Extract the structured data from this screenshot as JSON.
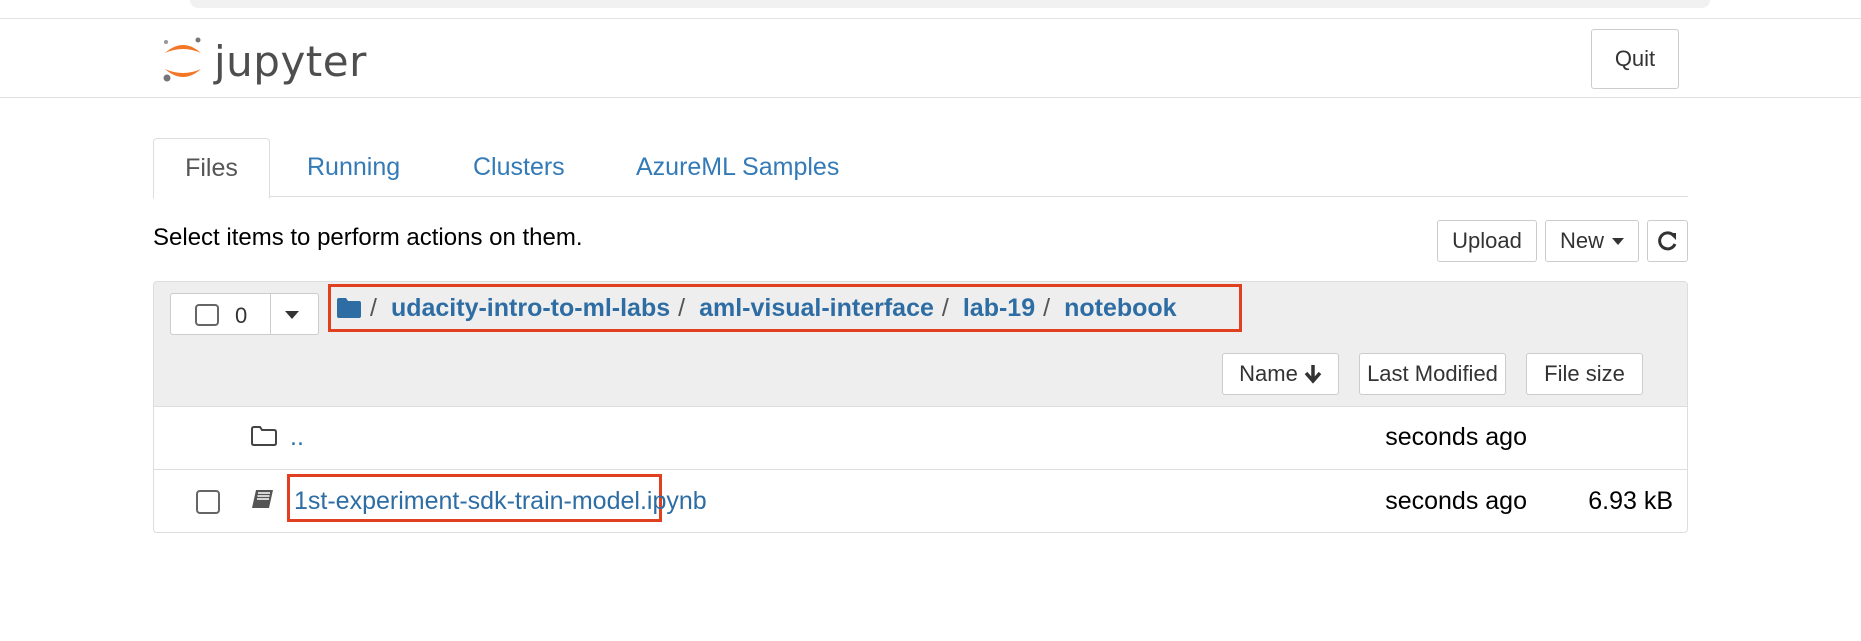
{
  "app": {
    "logo_text": "jupyter",
    "quit_label": "Quit"
  },
  "tabs": [
    {
      "label": "Files",
      "active": true
    },
    {
      "label": "Running",
      "active": false
    },
    {
      "label": "Clusters",
      "active": false
    },
    {
      "label": "AzureML Samples",
      "active": false
    }
  ],
  "toolbar": {
    "hint": "Select items to perform actions on them.",
    "upload_label": "Upload",
    "new_label": "New",
    "refresh_icon": "refresh-icon"
  },
  "selection": {
    "count": "0"
  },
  "breadcrumb": {
    "root_icon": "folder-icon",
    "separator": "/",
    "items": [
      "udacity-intro-to-ml-labs",
      "aml-visual-interface",
      "lab-19",
      "notebook"
    ]
  },
  "sort": {
    "name_label": "Name",
    "modified_label": "Last Modified",
    "size_label": "File size"
  },
  "rows": [
    {
      "name": "..",
      "icon": "folder-outline-icon",
      "modified": "seconds ago",
      "size": ""
    },
    {
      "name": "1st-experiment-sdk-train-model.ipynb",
      "icon": "notebook-icon",
      "modified": "seconds ago",
      "size": "6.93 kB"
    }
  ],
  "colors": {
    "link": "#2e6da4",
    "tab_link": "#337ab7",
    "highlight_border": "#e04020",
    "jupyter_orange": "#f37626"
  }
}
